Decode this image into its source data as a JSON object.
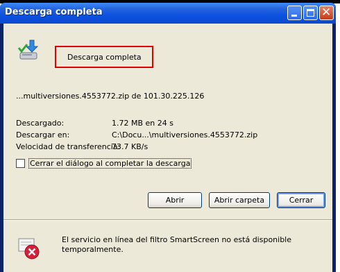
{
  "window": {
    "title": "Descarga completa"
  },
  "download": {
    "headline": "Descarga completa",
    "source": "...multiversiones.4553772.zip de 101.30.225.126",
    "downloaded_label": "Descargado:",
    "downloaded_value": "1.72 MB en 24 s",
    "saved_to_label": "Descargar en:",
    "saved_to_value": "C:\\Docu...\\multiversiones.4553772.zip",
    "speed_label": "Velocidad de transferencia:",
    "speed_value": "73.7 KB/s"
  },
  "options": {
    "close_on_complete": "Cerrar el diálogo al completar la descarga",
    "close_on_complete_checked": false
  },
  "buttons": {
    "open": "Abrir",
    "open_folder": "Abrir carpeta",
    "close": "Cerrar"
  },
  "smartscreen": {
    "message": "El servicio en línea del filtro SmartScreen no está disponible temporalmente."
  },
  "icons": {
    "download": "download-complete-icon",
    "error": "error-icon",
    "minimize": "minimize-icon",
    "maximize": "maximize-icon",
    "close": "close-icon"
  }
}
